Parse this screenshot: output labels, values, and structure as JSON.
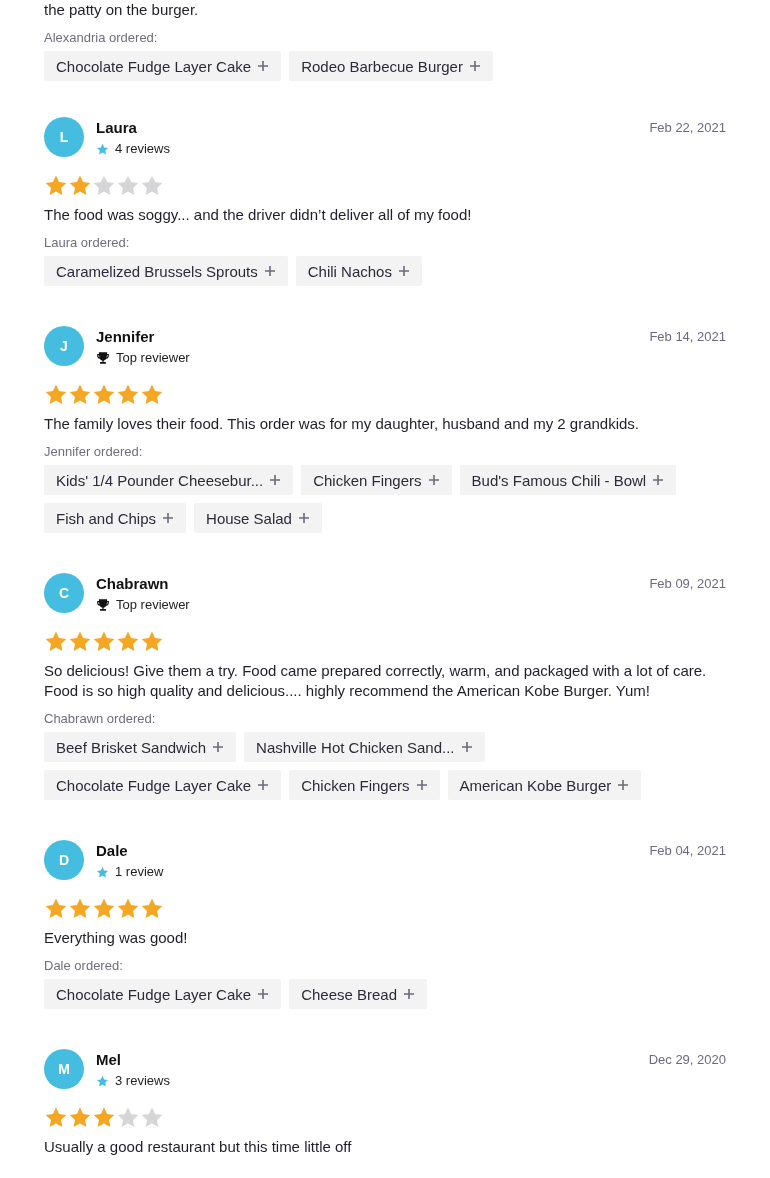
{
  "intro": {
    "text": "the patty on the burger.",
    "ordered_label": "Alexandria ordered:",
    "items": [
      "Chocolate Fudge Layer Cake",
      "Rodeo Barbecue Burger"
    ]
  },
  "reviews": [
    {
      "initial": "L",
      "name": "Laura",
      "badge": {
        "kind": "reviews",
        "text": "4 reviews"
      },
      "date": "Feb 22, 2021",
      "stars": 2,
      "text": "The food was soggy... and the driver didn’t deliver all of my food!",
      "ordered_label": "Laura ordered:",
      "items": [
        "Caramelized Brussels Sprouts",
        "Chili Nachos"
      ]
    },
    {
      "initial": "J",
      "name": "Jennifer",
      "badge": {
        "kind": "top",
        "text": "Top reviewer"
      },
      "date": "Feb 14, 2021",
      "stars": 5,
      "text": "The family loves their food. This order was for my daughter, husband and my 2 grandkids.",
      "ordered_label": "Jennifer ordered:",
      "items": [
        "Kids' 1/4 Pounder Cheesebur...",
        "Chicken Fingers",
        "Bud's Famous Chili - Bowl",
        "Fish and Chips",
        "House Salad"
      ]
    },
    {
      "initial": "C",
      "name": "Chabrawn",
      "badge": {
        "kind": "top",
        "text": "Top reviewer"
      },
      "date": "Feb 09, 2021",
      "stars": 5,
      "text": "So delicious! Give them a try. Food came prepared correctly, warm, and packaged with a lot of care. Food is so high quality and delicious.... highly recommend the American Kobe Burger. Yum!",
      "ordered_label": "Chabrawn ordered:",
      "items": [
        "Beef Brisket Sandwich",
        "Nashville Hot Chicken Sand...",
        "Chocolate Fudge Layer Cake",
        "Chicken Fingers",
        "American Kobe Burger"
      ]
    },
    {
      "initial": "D",
      "name": "Dale",
      "badge": {
        "kind": "reviews",
        "text": "1 review"
      },
      "date": "Feb 04, 2021",
      "stars": 5,
      "text": "Everything was good!",
      "ordered_label": "Dale ordered:",
      "items": [
        "Chocolate Fudge Layer Cake",
        "Cheese Bread"
      ]
    },
    {
      "initial": "M",
      "name": "Mel",
      "badge": {
        "kind": "reviews",
        "text": "3 reviews"
      },
      "date": "Dec 29, 2020",
      "stars": 3,
      "text": "Usually a good restaurant but this time little off"
    }
  ]
}
